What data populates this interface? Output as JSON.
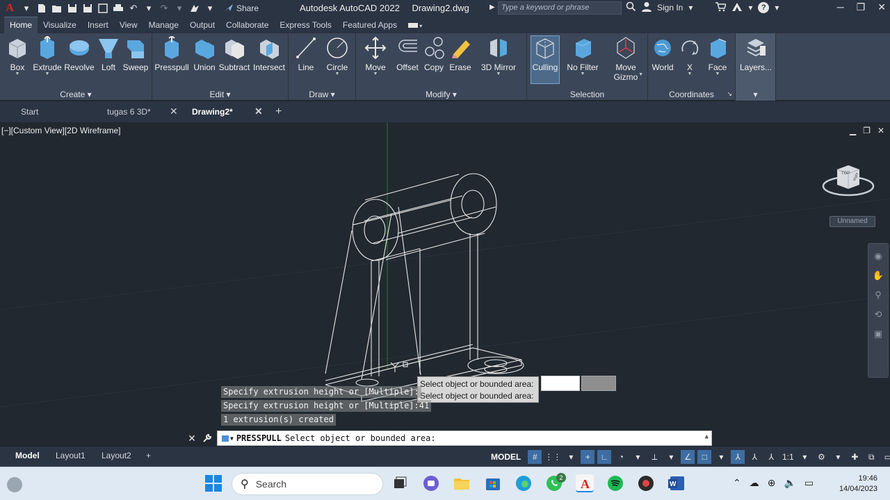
{
  "app": {
    "title": "Autodesk AutoCAD 2022",
    "filename": "Drawing2.dwg",
    "share_label": "Share",
    "search_placeholder": "Type a keyword or phrase",
    "sign_in_label": "Sign In"
  },
  "ribbon_tabs": [
    "Home",
    "Visualize",
    "Insert",
    "View",
    "Manage",
    "Output",
    "Collaborate",
    "Express Tools",
    "Featured Apps"
  ],
  "ribbon": {
    "panels": {
      "create": "Create",
      "edit": "Edit",
      "draw": "Draw",
      "modify": "Modify",
      "selection": "Selection",
      "coordinates": "Coordinates"
    },
    "tools": {
      "box": "Box",
      "extrude": "Extrude",
      "revolve": "Revolve",
      "loft": "Loft",
      "sweep": "Sweep",
      "presspull": "Presspull",
      "union": "Union",
      "subtract": "Subtract",
      "intersect": "Intersect",
      "line": "Line",
      "circle": "Circle",
      "move": "Move",
      "offset": "Offset",
      "copy": "Copy",
      "erase": "Erase",
      "mirror3d": "3D Mirror",
      "culling": "Culling",
      "no_filter": "No Filter",
      "move_gizmo_1": "Move",
      "move_gizmo_2": "Gizmo",
      "world": "World",
      "x": "X",
      "face": "Face",
      "layers": "Layers..."
    }
  },
  "doc_tabs": {
    "start": "Start",
    "tab1": "tugas 6 3D*",
    "tab2": "Drawing2*"
  },
  "viewport": {
    "label": "[−][Custom View][2D Wireframe]",
    "viewcube_label": "Unnamed",
    "viewcube_top": "TOP",
    "viewcube_right": "Right"
  },
  "prompt": {
    "tooltip_1": "Select object or bounded area:",
    "tooltip_2": "Select object or bounded area:",
    "history": [
      "Specify extrusion height or [Multiple]:",
      "Specify extrusion height or [Multiple]:41",
      "1 extrusion(s) created"
    ],
    "command_name": "PRESSPULL",
    "command_text": "Select object or bounded area:"
  },
  "layouts": [
    "Model",
    "Layout1",
    "Layout2"
  ],
  "status": {
    "model_label": "MODEL",
    "scale_label": "1:1"
  },
  "taskbar": {
    "search_label": "Search",
    "whatsapp_badge": "2",
    "time": "19:46",
    "date": "14/04/2023"
  },
  "colors": {
    "accent": "#3d6da3",
    "viewport_bg": "#212830",
    "autocad_red": "#e2231a"
  }
}
